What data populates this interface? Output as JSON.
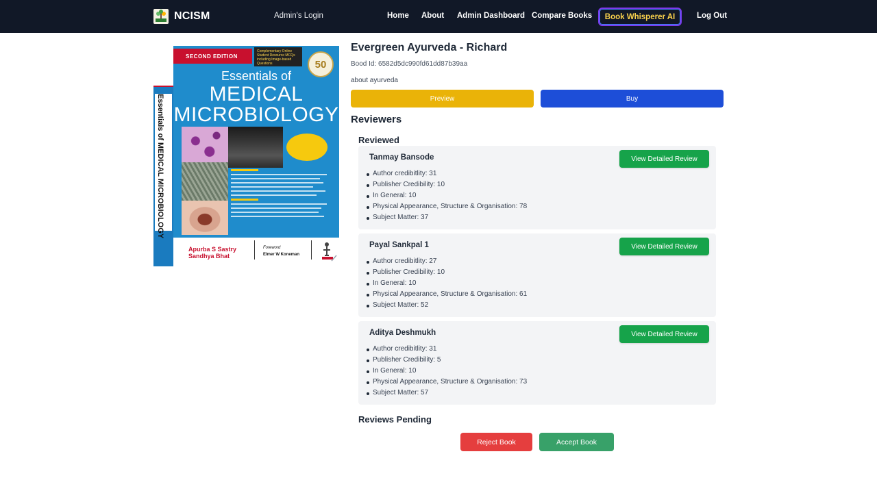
{
  "nav": {
    "brand": "NCISM",
    "admin_login": "Admin's Login",
    "links": [
      "Home",
      "About",
      "Admin Dashboard",
      "Compare Books"
    ],
    "ai_button": "Book Whisperer AI",
    "logout": "Log Out"
  },
  "cover": {
    "edition": "SECOND EDITION",
    "online_box": "Complementary Online Student Resource MCQs including Image-based Questions",
    "badge": "50",
    "title_line1": "Essentials of",
    "title_line2": "MEDICAL",
    "title_line3": "MICROBIOLOGY",
    "spine_title": "Essentials of MEDICAL MICROBIOLOGY",
    "author_line1": "Apurba S Sastry",
    "author_line2": "Sandhya Bhat",
    "foreword_label": "Foreword",
    "foreword_name": "Elmer W Koneman"
  },
  "book": {
    "title": "Evergreen Ayurveda - Richard",
    "id_text": "Bood Id: 6582d5dc990fd61dd87b39aa",
    "about": "about ayurveda",
    "preview_label": "Preview",
    "buy_label": "Buy"
  },
  "reviewers": {
    "heading": "Reviewers",
    "reviewed_heading": "Reviewed",
    "detail_button": "View Detailed Review",
    "items": [
      {
        "name": "Tanmay Bansode",
        "criteria": [
          "Author credibitlity: 31",
          "Publisher Credibility: 10",
          "In General: 10",
          "Physical Appearance, Structure & Organisation: 78",
          "Subject Matter: 37"
        ]
      },
      {
        "name": "Payal Sankpal 1",
        "criteria": [
          "Author credibitlity: 27",
          "Publisher Credibility: 10",
          "In General: 10",
          "Physical Appearance, Structure & Organisation: 61",
          "Subject Matter: 52"
        ]
      },
      {
        "name": "Aditya Deshmukh",
        "criteria": [
          "Author credibitlity: 31",
          "Publisher Credibility: 5",
          "In General: 10",
          "Physical Appearance, Structure & Organisation: 73",
          "Subject Matter: 57"
        ]
      }
    ],
    "pending_heading": "Reviews Pending"
  },
  "actions": {
    "reject": "Reject Book",
    "accept": "Accept Book"
  },
  "colors": {
    "navbar": "#111827",
    "preview": "#eab308",
    "buy": "#1d4ed8",
    "detail": "#16a34a",
    "reject": "#e53e3e",
    "accept": "#38a169"
  }
}
